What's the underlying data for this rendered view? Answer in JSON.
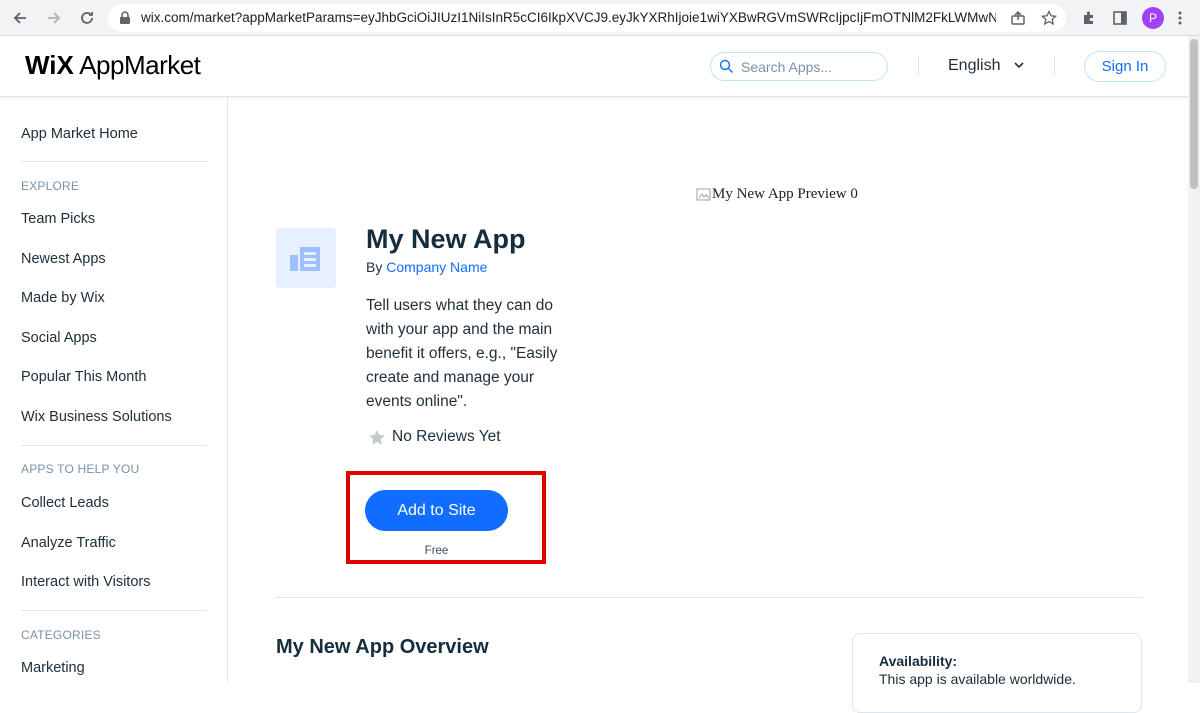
{
  "browser": {
    "url": "wix.com/market?appMarketParams=eyJhbGciOiJIUzI1NiIsInR5cCI6IkpXVCJ9.eyJkYXRhIjoie1wiYXBwRGVmSWRcIjpcIjFmOTNlM2FkLWMwN...",
    "avatar_letter": "P"
  },
  "header": {
    "logo_brand": "WiX",
    "logo_text": "AppMarket",
    "search_placeholder": "Search Apps...",
    "language": "English",
    "sign_in": "Sign In"
  },
  "sidebar": {
    "home": "App Market Home",
    "sections": [
      {
        "heading": "EXPLORE",
        "items": [
          "Team Picks",
          "Newest Apps",
          "Made by Wix",
          "Social Apps",
          "Popular This Month",
          "Wix Business Solutions"
        ]
      },
      {
        "heading": "APPS TO HELP YOU",
        "items": [
          "Collect Leads",
          "Analyze Traffic",
          "Interact with Visitors"
        ]
      },
      {
        "heading": "CATEGORIES",
        "items": [
          "Marketing"
        ]
      }
    ]
  },
  "app": {
    "title": "My New App",
    "by_label": "By",
    "company": "Company Name",
    "description": "Tell users what they can do with your app and the main benefit it offers, e.g., \"Easily create and manage your events online\".",
    "reviews": "No Reviews Yet",
    "add_button": "Add to Site",
    "price": "Free",
    "preview_alt": "My New App Preview 0",
    "overview_title": "My New App Overview",
    "availability_title": "Availability:",
    "availability_text": "This app is available worldwide."
  },
  "colors": {
    "accent": "#116dff",
    "highlight": "#e00000",
    "icon_bg": "#e7f0ff"
  }
}
